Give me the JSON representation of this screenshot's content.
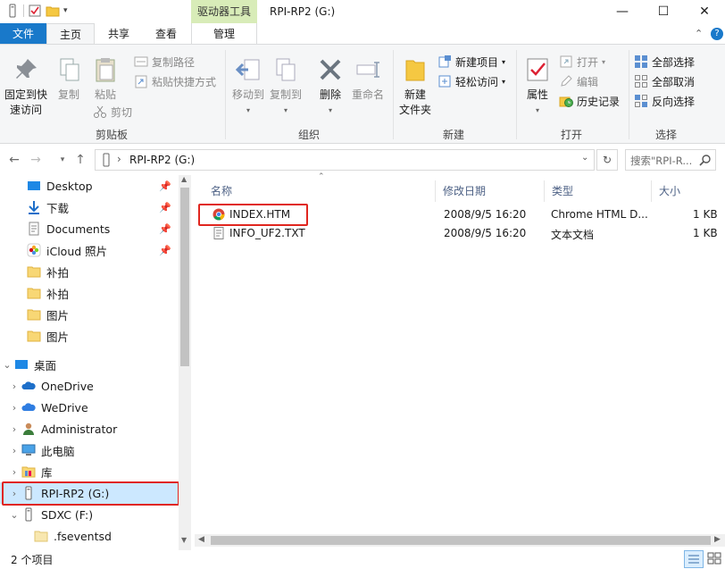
{
  "titlebar": {
    "context_tab": "驱动器工具",
    "title": "RPI-RP2 (G:)",
    "minimize": "—",
    "maximize": "☐",
    "close": "✕"
  },
  "tabs": {
    "file": "文件",
    "home": "主页",
    "share": "共享",
    "view": "查看",
    "manage": "管理"
  },
  "ribbon": {
    "clipboard": {
      "label": "剪贴板",
      "pin_to_quick_access": "固定到快\n速访问",
      "copy": "复制",
      "paste": "粘贴",
      "copy_path": "复制路径",
      "paste_shortcut": "粘贴快捷方式",
      "cut": "剪切"
    },
    "organize": {
      "label": "组织",
      "move_to": "移动到",
      "copy_to": "复制到",
      "delete": "删除",
      "rename": "重命名"
    },
    "new": {
      "label": "新建",
      "new_folder": "新建\n文件夹",
      "new_item": "新建项目",
      "easy_access": "轻松访问"
    },
    "open": {
      "label": "打开",
      "properties": "属性",
      "open": "打开",
      "edit": "编辑",
      "history": "历史记录"
    },
    "select": {
      "label": "选择",
      "select_all": "全部选择",
      "select_none": "全部取消",
      "invert": "反向选择"
    }
  },
  "address": {
    "path": "RPI-RP2 (G:)",
    "search_placeholder": "搜索\"RPI-R..."
  },
  "nav_items": [
    {
      "label": "Desktop",
      "pinned": true
    },
    {
      "label": "下载",
      "pinned": true
    },
    {
      "label": "Documents",
      "pinned": true
    },
    {
      "label": "iCloud 照片",
      "pinned": true
    },
    {
      "label": "补拍"
    },
    {
      "label": "补拍"
    },
    {
      "label": "图片"
    },
    {
      "label": "图片"
    },
    {
      "label": "桌面"
    },
    {
      "label": "OneDrive"
    },
    {
      "label": "WeDrive"
    },
    {
      "label": "Administrator"
    },
    {
      "label": "此电脑"
    },
    {
      "label": "库"
    },
    {
      "label": "RPI-RP2 (G:)"
    },
    {
      "label": "SDXC (F:)"
    },
    {
      "label": ".fseventsd"
    }
  ],
  "columns": {
    "name": "名称",
    "modified": "修改日期",
    "type": "类型",
    "size": "大小"
  },
  "files": [
    {
      "name": "INDEX.HTM",
      "modified": "2008/9/5 16:20",
      "type": "Chrome HTML D...",
      "size": "1 KB"
    },
    {
      "name": "INFO_UF2.TXT",
      "modified": "2008/9/5 16:20",
      "type": "文本文档",
      "size": "1 KB"
    }
  ],
  "status": {
    "count": "2 个项目"
  },
  "colors": {
    "accent": "#1979ca",
    "highlight": "#e0261f",
    "context_tab": "#d8ecb8",
    "selected_nav": "#cce8ff"
  }
}
